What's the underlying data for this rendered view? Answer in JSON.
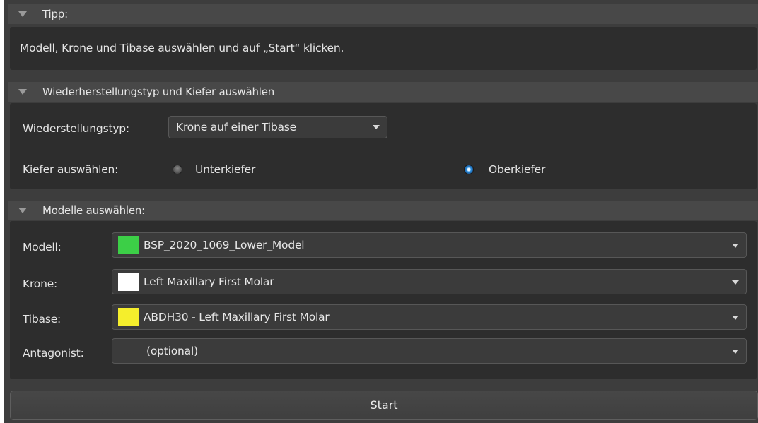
{
  "tip": {
    "header": "Tipp:",
    "text": "Modell, Krone und Tibase auswählen und auf „Start“ klicken."
  },
  "restoration": {
    "header": "Wiederherstellungstyp und Kiefer auswählen",
    "type_label": "Wiederstellungstyp:",
    "type_value": "Krone auf einer Tibase",
    "jaw_label": "Kiefer auswählen:",
    "jaw_options": [
      {
        "label": "Unterkiefer",
        "selected": false
      },
      {
        "label": "Oberkiefer",
        "selected": true
      }
    ]
  },
  "models": {
    "header": "Modelle auswählen:",
    "rows": [
      {
        "label": "Modell:",
        "value": "BSP_2020_1069_Lower_Model",
        "swatch": "#3ccf47"
      },
      {
        "label": "Krone:",
        "value": "Left Maxillary First Molar",
        "swatch": "#ffffff"
      },
      {
        "label": "Tibase:",
        "value": "ABDH30 - Left Maxillary First Molar",
        "swatch": "#f5ee2c"
      },
      {
        "label": "Antagonist:",
        "value": "(optional)",
        "swatch": null
      }
    ]
  },
  "start_label": "Start",
  "icons": {
    "section_toggle": "collapse-triangle-icon",
    "dropdown": "dropdown-arrow-icon"
  }
}
